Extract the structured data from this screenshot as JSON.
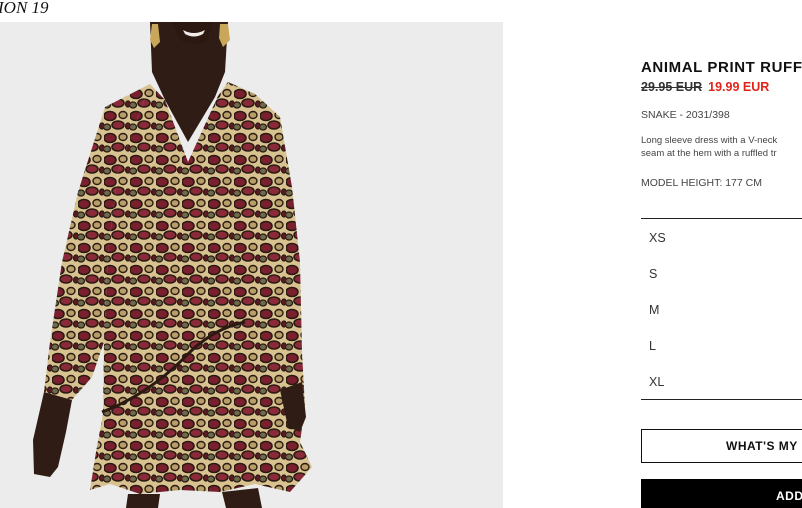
{
  "header": {
    "collection_title": "ION 19"
  },
  "product": {
    "name": "ANIMAL PRINT RUFF",
    "old_price": "29.95 EUR",
    "new_price": "19.99 EUR",
    "color_ref": "SNAKE - 2031/398",
    "description_lines": [
      "Long sleeve dress with a V-neck",
      "seam at the hem with a ruffled tr"
    ],
    "model_height": "MODEL HEIGHT: 177 CM",
    "image_alt": "Model wearing animal print ruffle dress"
  },
  "sizes": [
    "XS",
    "S",
    "M",
    "L",
    "XL"
  ],
  "actions": {
    "size_guide_label": "WHAT'S MY",
    "add_label": "ADD"
  },
  "colors": {
    "sale_red": "#e2231a",
    "image_bg": "#ececec",
    "button_black": "#000000"
  }
}
